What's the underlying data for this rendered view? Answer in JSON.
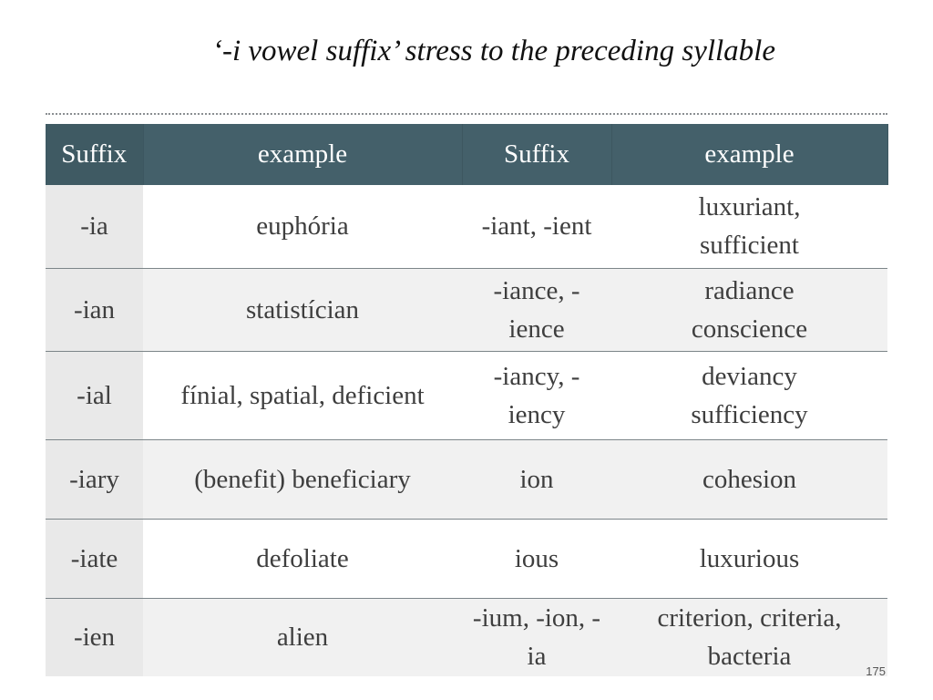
{
  "title": "‘-i vowel suffix’ stress to the preceding syllable",
  "table": {
    "headers": [
      "Suffix",
      "example",
      "Suffix",
      "example"
    ],
    "rows": [
      [
        "-ia",
        "euphória",
        "-iant, -ient",
        "luxuriant, sufficient"
      ],
      [
        "-ian",
        "statistícian",
        "-iance, -ience",
        "radiance conscience"
      ],
      [
        "-ial",
        "fínial, spatial, deficient",
        "-iancy, -iency",
        "deviancy sufficiency"
      ],
      [
        "-iary",
        "(benefit) beneficiary",
        "ion",
        "cohesion"
      ],
      [
        "-iate",
        "defoliate",
        "ious",
        "luxurious"
      ],
      [
        "-ien",
        "alien",
        "-ium, -ion, -ia",
        "criterion, criteria, bacteria"
      ]
    ]
  },
  "page_number": "175"
}
